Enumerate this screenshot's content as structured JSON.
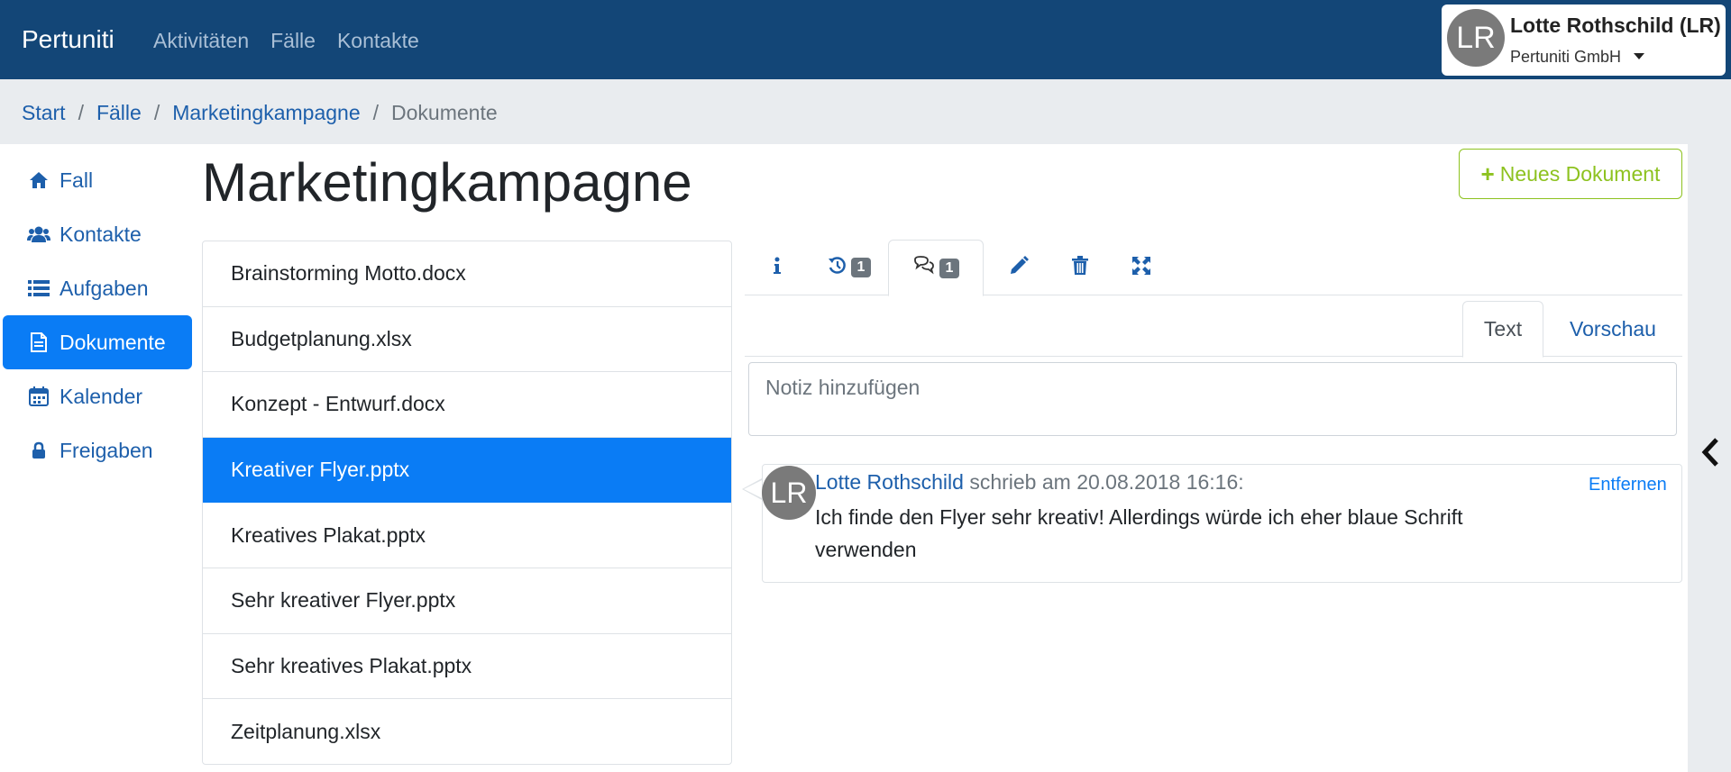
{
  "navbar": {
    "brand": "Pertuniti",
    "links": [
      "Aktivitäten",
      "Fälle",
      "Kontakte"
    ],
    "user": {
      "initials": "LR",
      "name": "Lotte Rothschild (LR)",
      "organization": "Pertuniti GmbH"
    }
  },
  "breadcrumb": {
    "items": [
      "Start",
      "Fälle",
      "Marketingkampagne"
    ],
    "current": "Dokumente"
  },
  "sidebar": {
    "items": [
      {
        "label": "Fall",
        "icon": "home-icon"
      },
      {
        "label": "Kontakte",
        "icon": "users-icon"
      },
      {
        "label": "Aufgaben",
        "icon": "list-icon"
      },
      {
        "label": "Dokumente",
        "icon": "document-icon",
        "active": true
      },
      {
        "label": "Kalender",
        "icon": "calendar-icon"
      },
      {
        "label": "Freigaben",
        "icon": "lock-icon"
      }
    ]
  },
  "main": {
    "title": "Marketingkampagne",
    "new_document_label": "Neues Dokument"
  },
  "documents": {
    "items": [
      "Brainstorming Motto.docx",
      "Budgetplanung.xlsx",
      "Konzept - Entwurf.docx",
      "Kreativer Flyer.pptx",
      "Kreatives Plakat.pptx",
      "Sehr kreativer Flyer.pptx",
      "Sehr kreatives Plakat.pptx",
      "Zeitplanung.xlsx"
    ],
    "selected": "Kreativer Flyer.pptx"
  },
  "detail_tabs": {
    "history_count": "1",
    "comments_count": "1"
  },
  "note_editor": {
    "tab_text": "Text",
    "tab_preview": "Vorschau",
    "placeholder": "Notiz hinzufügen"
  },
  "comment": {
    "initials": "LR",
    "author": "Lotte Rothschild",
    "meta": "schrieb am 20.08.2018 16:16:",
    "text": "Ich finde den Flyer sehr kreativ! Allerdings würde ich eher blaue Schrift verwenden",
    "remove_label": "Entfernen"
  },
  "colors": {
    "navbar": "#134677",
    "primary": "#0a7cf5",
    "link": "#1d5fab",
    "success": "#8dc21f"
  }
}
